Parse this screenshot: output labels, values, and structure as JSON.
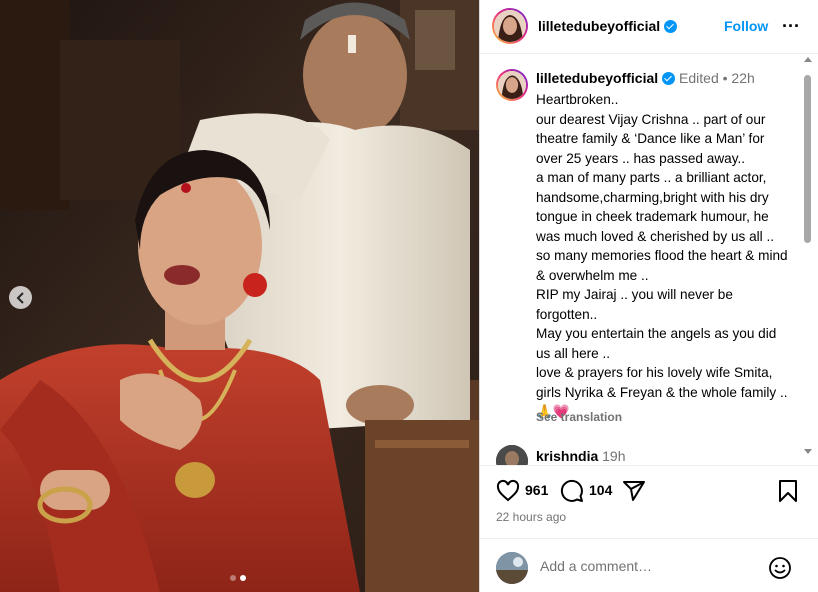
{
  "post": {
    "username": "lilletedubeyofficial",
    "follow_label": "Follow",
    "more_label": "···",
    "edited_label": "Edited",
    "dot_sep": "•",
    "time": "22h",
    "caption": "Heartbroken..\nour dearest Vijay Crishna .. part of our theatre family & ‘Dance like a Man’ for over 25 years .. has passed away..\na man of many parts .. a brilliant actor, handsome,charming,bright with his dry tongue in cheek trademark humour, he was much loved & cherished by us all ..\nso many memories flood the heart & mind & overwhelm me ..\nRIP my Jairaj .. you will never be forgotten..\nMay you entertain the angels as you did us all here ..\nlove & prayers for his lovely wife Smita, girls Nyrika & Freyan & the whole family ..\n🙏💗",
    "see_translation": "See translation",
    "next_comment_user": "krishndia",
    "next_comment_time": "19h",
    "likes": "961",
    "comments": "104",
    "time_ago": "22 hours ago",
    "comment_placeholder": "Add a comment…"
  },
  "carousel": {
    "slide_count": 2,
    "active_index": 1
  },
  "colors": {
    "accent": "#0095f6",
    "muted": "#737373",
    "border": "#dbdbdb"
  },
  "icons": [
    "verified-badge-icon",
    "more-options-icon",
    "carousel-prev-icon",
    "heart-icon",
    "comment-icon",
    "share-icon",
    "bookmark-icon",
    "emoji-icon"
  ]
}
